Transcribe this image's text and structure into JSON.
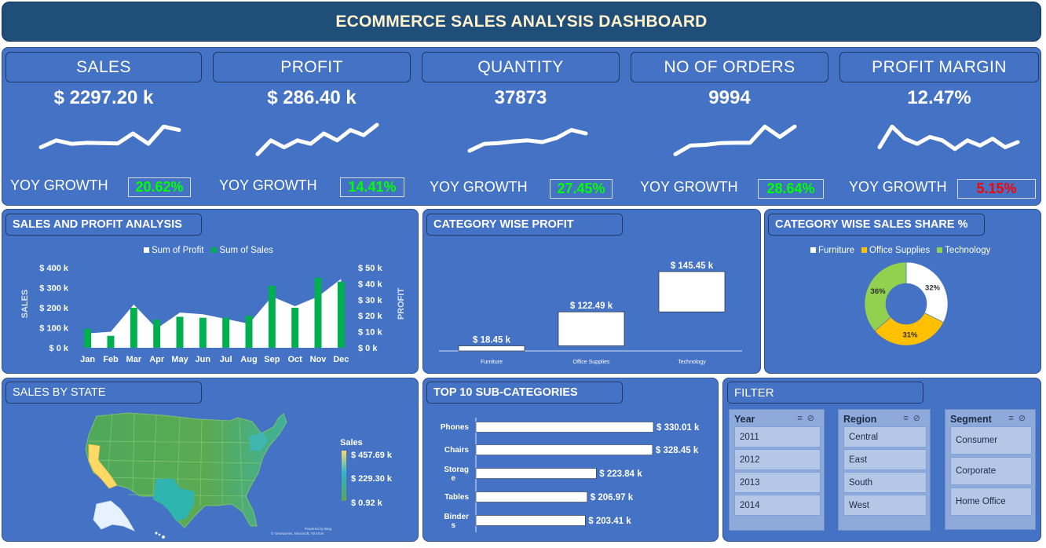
{
  "title": "ECOMMERCE SALES ANALYSIS DASHBOARD",
  "kpis": [
    {
      "label": "SALES",
      "value": "$ 2297.20 k",
      "yoy_label": "YOY GROWTH",
      "yoy": "20.62%",
      "yoy_color": "#00ff00"
    },
    {
      "label": "PROFIT",
      "value": "$ 286.40 k",
      "yoy_label": "YOY GROWTH",
      "yoy": "14.41%",
      "yoy_color": "#00ff00"
    },
    {
      "label": "QUANTITY",
      "value": "37873",
      "yoy_label": "YOY GROWTH",
      "yoy": "27.45%",
      "yoy_color": "#00ff00"
    },
    {
      "label": "NO OF ORDERS",
      "value": "9994",
      "yoy_label": "YOY GROWTH",
      "yoy": "28.64%",
      "yoy_color": "#00ff00"
    },
    {
      "label": "PROFIT MARGIN",
      "value": "12.47%",
      "yoy_label": "YOY GROWTH",
      "yoy": "5.15%",
      "yoy_color": "#ff0000"
    }
  ],
  "sales_profit": {
    "header": "SALES AND PROFIT ANALYSIS",
    "legend": [
      "Sum of Profit",
      "Sum of Sales"
    ],
    "ylabel": "SALES",
    "y2label": "PROFIT",
    "y_ticks": [
      "$ 400 k",
      "$ 300 k",
      "$ 200 k",
      "$ 100 k",
      "$ 0 k"
    ],
    "y2_ticks": [
      "$ 50 k",
      "$ 40 k",
      "$ 30 k",
      "$ 20 k",
      "$ 10 k",
      "$ 0 k"
    ]
  },
  "category_profit": {
    "header": "CATEGORY WISE PROFIT",
    "labels": [
      "$ 18.45 k",
      "$ 122.49 k",
      "$ 145.45 k"
    ]
  },
  "category_share": {
    "header": "CATEGORY WISE SALES SHARE %",
    "legend": [
      "Furniture",
      "Office Supplies",
      "Technology"
    ],
    "labels": [
      "32%",
      "31%",
      "36%"
    ]
  },
  "state": {
    "header": "SALES BY STATE",
    "legend_title": "Sales",
    "legend_values": [
      "$ 457.69 k",
      "$ 229.30 k",
      "$ 0.92 k"
    ],
    "credit_1": "Powered by Bing",
    "credit_2": "© GeoNames, Microsoft, TomTom"
  },
  "subcat": {
    "header": "TOP 10 SUB-CATEGORIES",
    "labels": [
      "Phones",
      "Chairs",
      "Storag\ne",
      "Tables",
      "Binder\ns"
    ],
    "values_text": [
      "$ 330.01 k",
      "$ 328.45 k",
      "$ 223.84 k",
      "$ 206.97 k",
      "$ 203.41 k"
    ]
  },
  "filter": {
    "header": "FILTER",
    "slicers": [
      {
        "title": "Year",
        "items": [
          "2011",
          "2012",
          "2013",
          "2014"
        ]
      },
      {
        "title": "Region",
        "items": [
          "Central",
          "East",
          "South",
          "West"
        ]
      },
      {
        "title": "Segment",
        "items": [
          "Consumer",
          "Corporate",
          "Home Office"
        ]
      }
    ]
  },
  "chart_data": [
    {
      "type": "bar",
      "title": "SALES AND PROFIT ANALYSIS",
      "categories": [
        "Jan",
        "Feb",
        "Mar",
        "Apr",
        "May",
        "Jun",
        "Jul",
        "Aug",
        "Sep",
        "Oct",
        "Nov",
        "Dec"
      ],
      "series": [
        {
          "name": "Sum of Sales",
          "type": "bar",
          "axis": "left",
          "values": [
            95,
            60,
            200,
            140,
            155,
            150,
            150,
            160,
            310,
            200,
            350,
            330
          ]
        },
        {
          "name": "Sum of Profit",
          "type": "area",
          "axis": "right",
          "values": [
            9,
            10,
            27,
            12,
            22,
            21,
            18,
            15,
            32,
            26,
            32,
            43
          ]
        }
      ],
      "ylabel": "SALES",
      "ylim": [
        0,
        400
      ],
      "y2label": "PROFIT",
      "y2lim": [
        0,
        50
      ],
      "legend": "top"
    },
    {
      "type": "bar",
      "title": "CATEGORY WISE PROFIT",
      "categories": [
        "Furniture",
        "Office Supplies",
        "Technology"
      ],
      "values": [
        18.45,
        122.49,
        145.45
      ],
      "note": "waterfall"
    },
    {
      "type": "pie",
      "title": "CATEGORY WISE SALES SHARE %",
      "categories": [
        "Furniture",
        "Office Supplies",
        "Technology"
      ],
      "values": [
        32,
        31,
        36
      ],
      "colors": [
        "#ffffff",
        "#ffc000",
        "#92d050"
      ],
      "legend": "top"
    },
    {
      "type": "bar",
      "title": "TOP 10 SUB-CATEGORIES",
      "orientation": "horizontal",
      "categories": [
        "Phones",
        "Chairs",
        "Storage",
        "Tables",
        "Binders"
      ],
      "values": [
        330.01,
        328.45,
        223.84,
        206.97,
        203.41
      ]
    }
  ],
  "sparklines": [
    [
      0.35,
      0.55,
      0.45,
      0.48,
      0.47,
      0.46,
      0.75,
      0.45,
      0.95,
      0.85
    ],
    [
      0.15,
      0.55,
      0.35,
      0.55,
      0.45,
      0.75,
      0.55,
      0.85,
      0.7,
      1.0
    ],
    [
      0.25,
      0.45,
      0.47,
      0.52,
      0.55,
      0.5,
      0.62,
      0.85,
      0.75
    ],
    [
      0.15,
      0.4,
      0.42,
      0.47,
      0.48,
      0.48,
      0.95,
      0.65,
      0.95
    ],
    [
      0.35,
      0.95,
      0.6,
      0.45,
      0.65,
      0.55,
      0.3,
      0.55,
      0.4,
      0.6,
      0.35,
      0.5
    ]
  ],
  "colors": {
    "panel": "#4472c4",
    "title_bar": "#1f4e79",
    "title_text": "#fff2cc",
    "sales_bar": "#00b050",
    "profit_area": "#ffffff",
    "map_high": "#ffd966",
    "map_mid": "#2eb5b0",
    "map_low": "#5aa84f"
  }
}
